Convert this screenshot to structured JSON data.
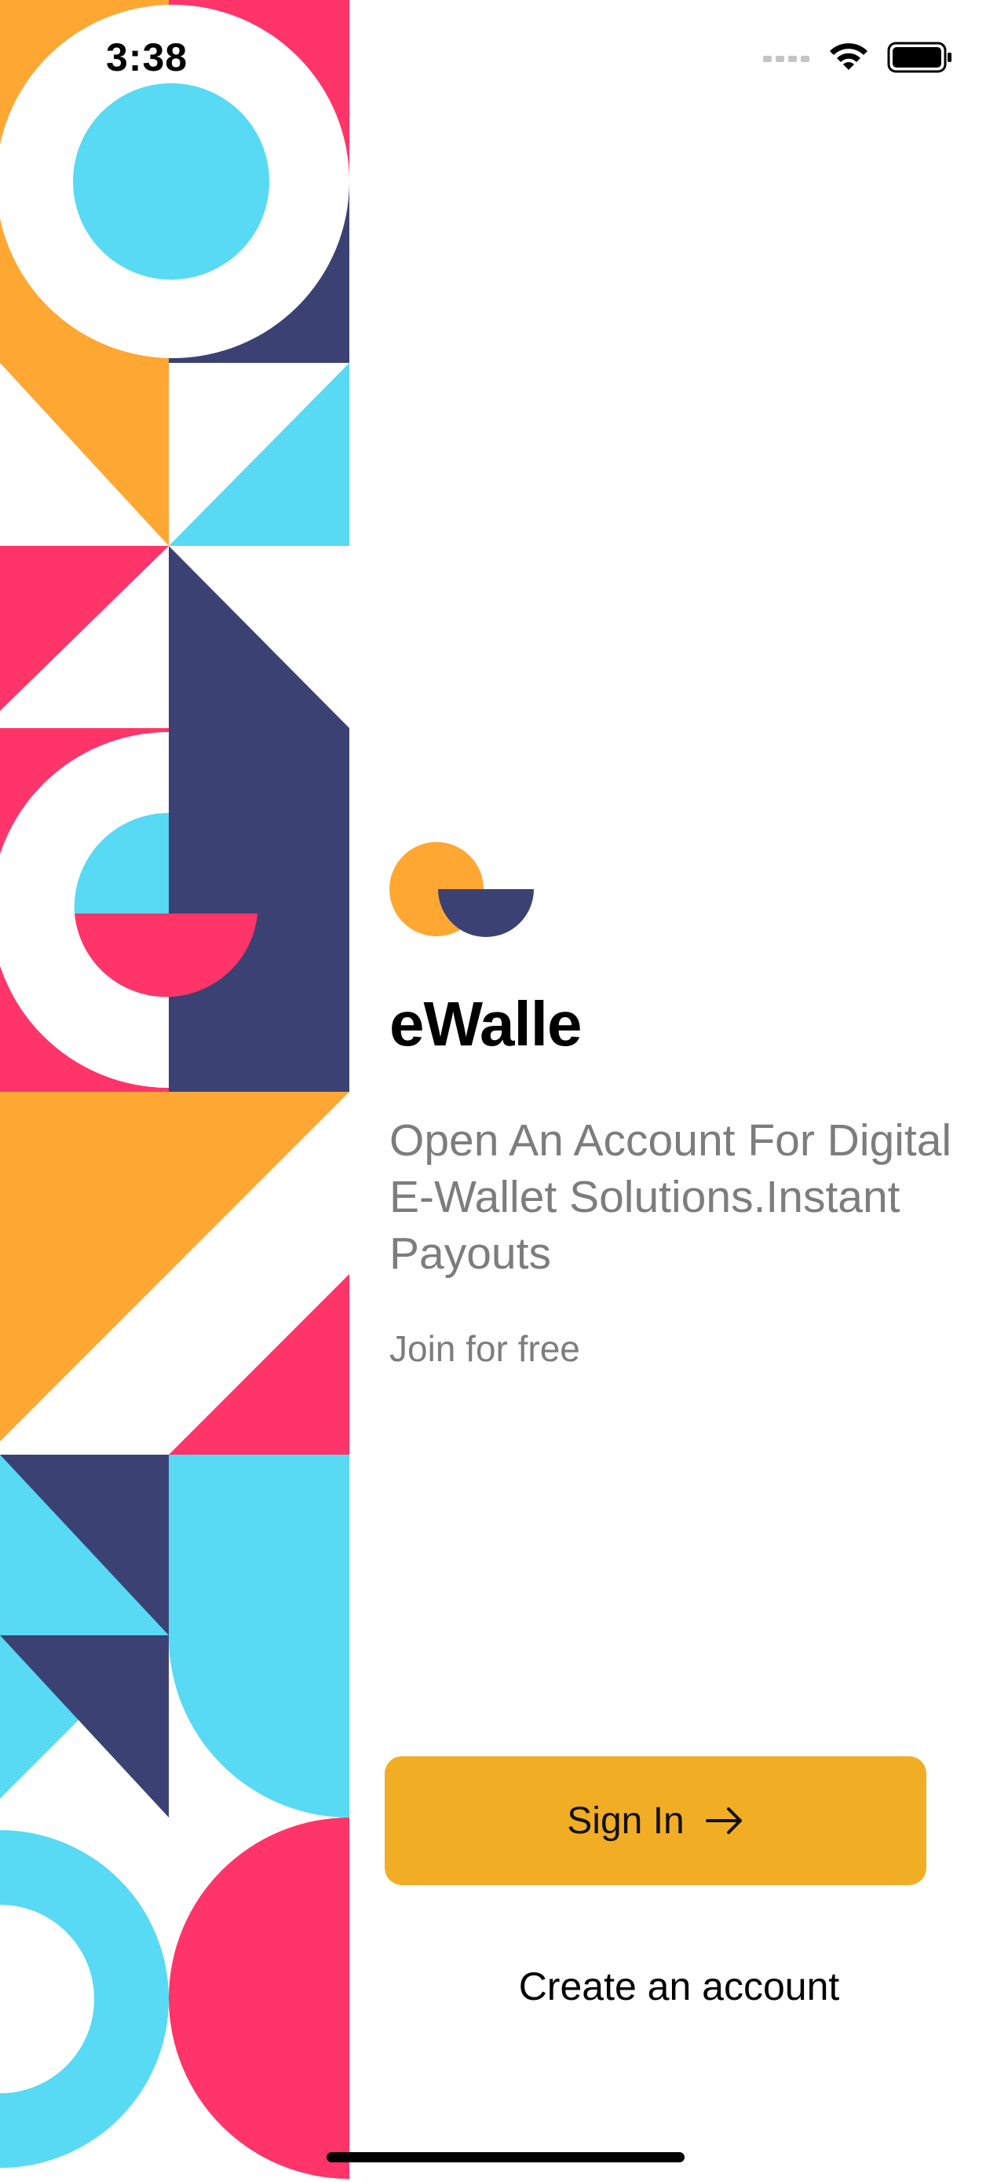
{
  "status_bar": {
    "time": "3:38",
    "icons": [
      "cellular-signal-icon",
      "wifi-icon",
      "battery-icon"
    ]
  },
  "app": {
    "title": "eWalle",
    "tagline": "Open An Account For Digital E-Wallet Solutions.Instant Payouts",
    "join_text": "Join for free"
  },
  "actions": {
    "sign_in_label": "Sign In",
    "sign_in_icon": "arrow-right-icon",
    "create_account_label": "Create an account"
  },
  "colors": {
    "accent": "#f1ae25",
    "pattern_orange": "#ffa733",
    "pattern_pink": "#ff3469",
    "pattern_cyan": "#58d9f4",
    "pattern_navy": "#3b4273",
    "text_muted": "#7d7d7d"
  }
}
